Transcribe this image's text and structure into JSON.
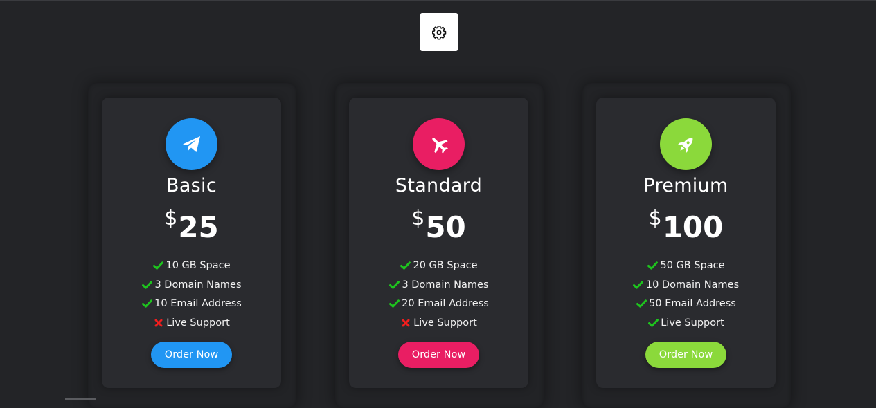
{
  "theme_toggle": {
    "icon": "gear-icon"
  },
  "plans": [
    {
      "name": "Basic",
      "currency": "$",
      "price": "25",
      "accent": "#2196f3",
      "icon": "paper-plane-icon",
      "features": [
        {
          "text": "10 GB Space",
          "included": true
        },
        {
          "text": "3 Domain Names",
          "included": true
        },
        {
          "text": "10 Email Address",
          "included": true
        },
        {
          "text": "Live Support",
          "included": false
        }
      ],
      "button": "Order Now"
    },
    {
      "name": "Standard",
      "currency": "$",
      "price": "50",
      "accent": "#e91e63",
      "icon": "airplane-icon",
      "features": [
        {
          "text": "20 GB Space",
          "included": true
        },
        {
          "text": "3 Domain Names",
          "included": true
        },
        {
          "text": "20 Email Address",
          "included": true
        },
        {
          "text": "Live Support",
          "included": false
        }
      ],
      "button": "Order Now"
    },
    {
      "name": "Premium",
      "currency": "$",
      "price": "100",
      "accent": "#8bd93b",
      "icon": "rocket-icon",
      "features": [
        {
          "text": "50 GB Space",
          "included": true
        },
        {
          "text": "10 Domain Names",
          "included": true
        },
        {
          "text": "50 Email Address",
          "included": true
        },
        {
          "text": "Live Support",
          "included": true
        }
      ],
      "button": "Order Now"
    }
  ],
  "colors": {
    "background": "#232427",
    "check": "#1ec31e",
    "cross": "#f01e1e"
  }
}
